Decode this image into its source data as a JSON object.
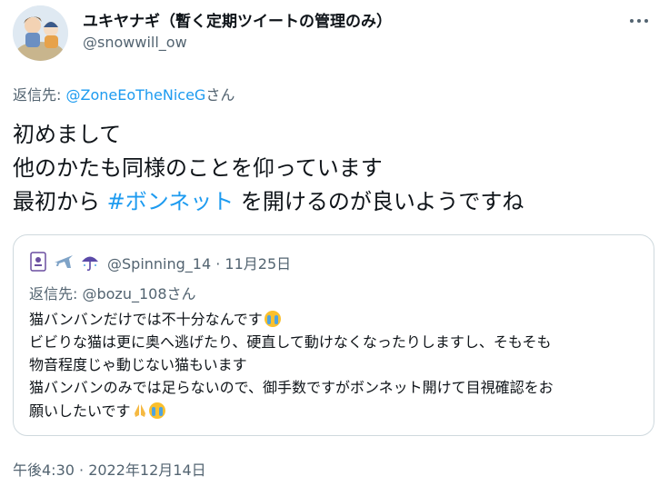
{
  "author": {
    "display_name": "ユキヤナギ（暫く定期ツイートの管理のみ）",
    "handle": "@snowwill_ow"
  },
  "reply": {
    "prefix": "返信先: ",
    "mention": "@ZoneEoTheNiceG",
    "suffix": "さん"
  },
  "tweet": {
    "line1": "初めまして",
    "line2": "他のかたも同様のことを仰っています",
    "line3_pre": "最初から ",
    "hashtag": "#ボンネット",
    "line3_post": " を開けるのが良いようですね"
  },
  "quoted": {
    "icons": [
      "tarot-card-icon",
      "airplane-icon",
      "umbrella-icon"
    ],
    "handle_date": "@Spinning_14 · 11月25日",
    "reply_to": "返信先: @bozu_108さん",
    "line1": "猫バンバンだけでは不十分なんです",
    "line2": "ビビりな猫は更に奥へ逃げたり、硬直して動けなくなったりしますし、そもそも",
    "line3": "物音程度じゃ動じない猫もいます",
    "line4": "猫バンバンのみでは足らないので、御手数ですがボンネット開けて目視確認をお",
    "line5": "願いしたいです"
  },
  "meta": {
    "timestamp": "午後4:30 · 2022年12月14日"
  },
  "colors": {
    "link": "#1d9bf0",
    "secondary_text": "#536471",
    "border": "#cfd9de"
  }
}
